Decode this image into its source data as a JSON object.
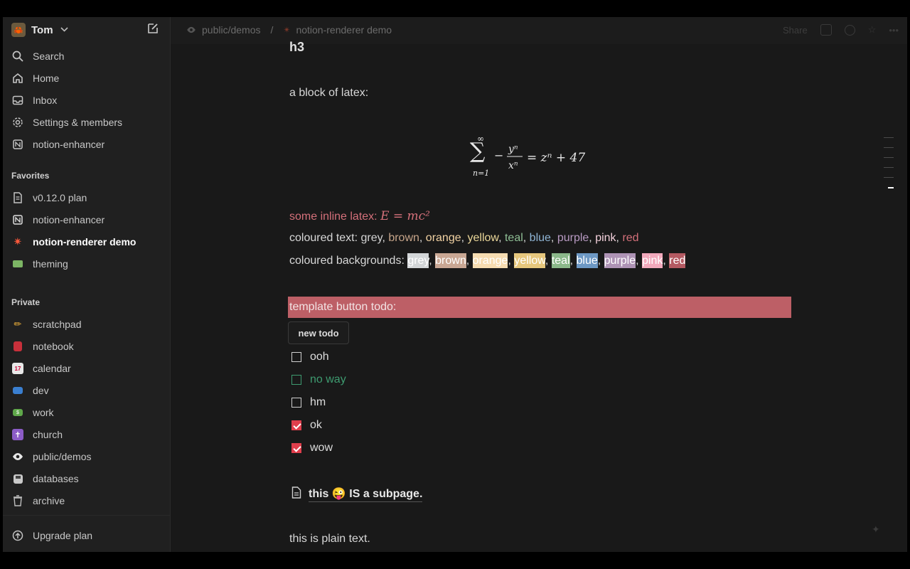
{
  "sidebar": {
    "workspace": {
      "name": "Tom",
      "avatar": "🦀"
    },
    "top_items": [
      {
        "label": "Search",
        "icon": "search-icon"
      },
      {
        "label": "Home",
        "icon": "home-icon"
      },
      {
        "label": "Inbox",
        "icon": "inbox-icon"
      },
      {
        "label": "Settings & members",
        "icon": "gear-icon"
      },
      {
        "label": "notion-enhancer",
        "icon": "enhancer-icon"
      }
    ],
    "favorites_label": "Favorites",
    "favorites": [
      {
        "label": "v0.12.0 plan",
        "icon": "page-icon"
      },
      {
        "label": "notion-enhancer",
        "icon": "enhancer-icon"
      },
      {
        "label": "notion-renderer demo",
        "icon": "sparkle-icon",
        "active": true
      },
      {
        "label": "theming",
        "icon": "palette-icon"
      }
    ],
    "private_label": "Private",
    "private": [
      {
        "label": "scratchpad",
        "icon": "pencil-icon"
      },
      {
        "label": "notebook",
        "icon": "notebook-icon"
      },
      {
        "label": "calendar",
        "icon": "calendar-icon"
      },
      {
        "label": "dev",
        "icon": "laptop-icon"
      },
      {
        "label": "work",
        "icon": "money-icon"
      },
      {
        "label": "church",
        "icon": "cross-icon"
      },
      {
        "label": "public/demos",
        "icon": "eye-icon"
      },
      {
        "label": "databases",
        "icon": "floppy-icon"
      },
      {
        "label": "archive",
        "icon": "trash-icon"
      }
    ],
    "upgrade_label": "Upgrade plan"
  },
  "topbar": {
    "crumb1": "public/demos",
    "separator": "/",
    "crumb2": "notion-renderer demo",
    "share": "Share"
  },
  "page": {
    "heading": "h3",
    "latex_intro": "a block of latex:",
    "latex_block": {
      "sum_top": "∞",
      "sum_bottom": "n=1",
      "num": "yⁿ",
      "den": "xⁿ",
      "rhs": "= zⁿ + 47"
    },
    "inline_latex_label": "some inline latex: ",
    "inline_latex": "E = mc²",
    "coloured_text_label": "coloured text: ",
    "coloured_text": [
      {
        "word": "grey",
        "color": "#d4d4d4"
      },
      {
        "word": "brown",
        "color": "#c7a58a"
      },
      {
        "word": "orange",
        "color": "#f2d2a3"
      },
      {
        "word": "yellow",
        "color": "#ecd89a"
      },
      {
        "word": "teal",
        "color": "#8fbf95"
      },
      {
        "word": "blue",
        "color": "#8fb4d4"
      },
      {
        "word": "purple",
        "color": "#b89ac2"
      },
      {
        "word": "pink",
        "color": "#f4d1dc"
      },
      {
        "word": "red",
        "color": "#d4707a"
      }
    ],
    "coloured_bg_label": "coloured backgrounds: ",
    "coloured_bgs": [
      {
        "word": "grey",
        "color": "#d3d6d8"
      },
      {
        "word": "brown",
        "color": "#c9a794"
      },
      {
        "word": "orange",
        "color": "#f6dcb1"
      },
      {
        "word": "yellow",
        "color": "#e6c77d"
      },
      {
        "word": "teal",
        "color": "#8bb88a"
      },
      {
        "word": "blue",
        "color": "#6d98c4"
      },
      {
        "word": "purple",
        "color": "#ae93b5"
      },
      {
        "word": "pink",
        "color": "#f2a9bc"
      },
      {
        "word": "red",
        "color": "#b45a62"
      }
    ],
    "todo_heading": "template button todo:",
    "new_todo_button": "new todo",
    "todos": [
      {
        "label": "ooh",
        "checked": false
      },
      {
        "label": "no way",
        "checked": false,
        "color": "#3e9b70"
      },
      {
        "label": "hm",
        "checked": false
      },
      {
        "label": "ok",
        "checked": true
      },
      {
        "label": "wow",
        "checked": true
      }
    ],
    "subpage_text": "this 😜 IS a subpage.",
    "plain_text": "this is plain text."
  },
  "colors": {
    "accent": "#e03e4c",
    "todo_bg": "#bd5f66",
    "inline_latex": "#d4707a"
  }
}
